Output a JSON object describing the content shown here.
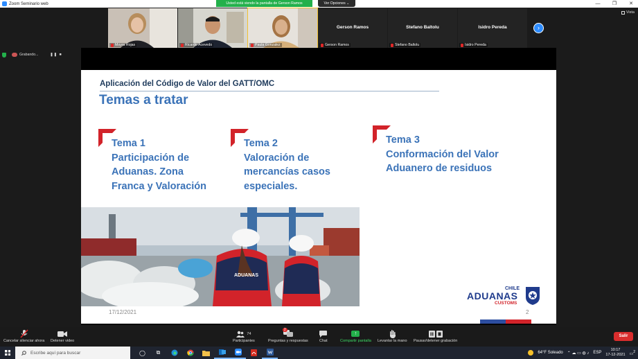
{
  "window": {
    "title": "Zoom Seminario web",
    "controls": [
      "—",
      "❐",
      "✕"
    ]
  },
  "banner": {
    "sharing_text": "Usted está viendo la pantalla de Gerson Ramos",
    "view_options": "Ver Opciones ⌄",
    "vista": "Vista"
  },
  "participants": [
    {
      "name": "Moyra Rojas",
      "video": true
    },
    {
      "name": "Ricardo Acevedo",
      "video": true
    },
    {
      "name": "Paula Gonzalez",
      "video": true
    },
    {
      "name": "Gerson Ramos",
      "video": false
    },
    {
      "name": "Stefano Baltolu",
      "video": false
    },
    {
      "name": "Isidro Pereda",
      "video": false
    }
  ],
  "recording": {
    "label": "Grabando...",
    "controls": "❚❚ ■"
  },
  "slide": {
    "heading": "Aplicación del Código de Valor del GATT/OMC",
    "title": "Temas a tratar",
    "topics": [
      {
        "lines": [
          "Tema 1",
          "Participación de",
          "Aduanas. Zona",
          "Franca y Valoración"
        ]
      },
      {
        "lines": [
          "Tema 2",
          "Valoración de",
          "mercancías casos",
          "especiales."
        ]
      },
      {
        "lines": [
          "Tema 3",
          "Conformación del Valor",
          "Aduanero de residuos"
        ]
      }
    ],
    "date": "17/12/2021",
    "page_number": "2",
    "photo_vest_text": "ADUANAS",
    "logo": {
      "small": "CHILE",
      "big": "ADUANAS",
      "sub": "CUSTOMS"
    }
  },
  "toolbar": {
    "unmute": "Cancelar silenciar ahora",
    "stop_video": "Detener video",
    "participants": "Participantes",
    "participants_count": "74",
    "qa": "Preguntas y respuestas",
    "qa_badge": "2",
    "chat": "Chat",
    "share": "Compartir pantalla",
    "raise_hand": "Levantar la mano",
    "pause_recording": "Pausar/detener grabación",
    "leave": "Salir"
  },
  "taskbar": {
    "search_placeholder": "Escribe aquí para buscar",
    "weather": "64°F  Soleado",
    "lang": "ESP",
    "time": "10:17",
    "date": "17-12-2021",
    "notif_count": "2"
  }
}
